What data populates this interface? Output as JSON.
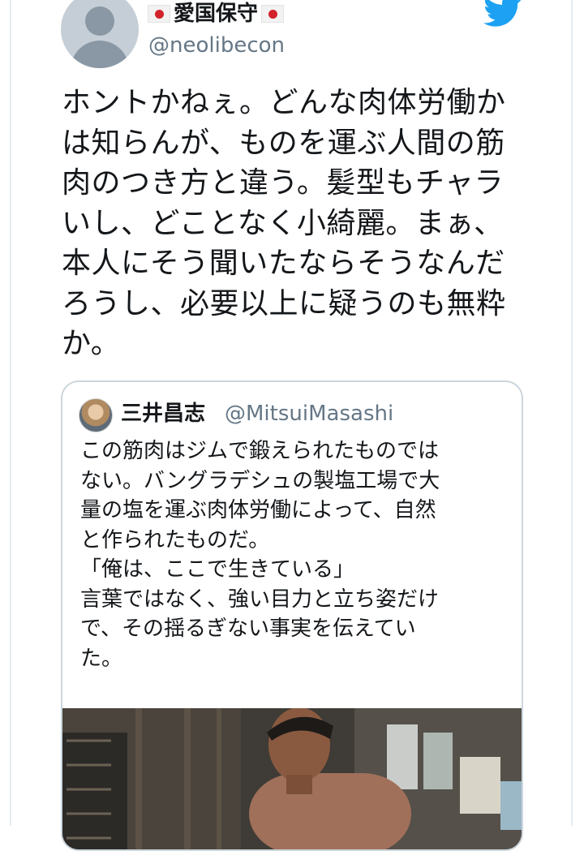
{
  "author": {
    "display_name": "愛国保守",
    "handle": "@neolibecon",
    "avatar_icon": "default-profile-icon",
    "flag_icon": "japan-flag-icon"
  },
  "brand": {
    "icon": "twitter-bird-icon",
    "color": "#1da1f2"
  },
  "tweet": {
    "lines": [
      "ホントかねぇ。どんな肉体労働か",
      "は知らんが、ものを運ぶ人間の筋",
      "肉のつき方と違う。髪型もチャラ",
      "いし、どことなく小綺麗。まぁ、",
      "本人にそう聞いたならそうなんだ",
      "ろうし、必要以上に疑うのも無粋",
      "か。"
    ]
  },
  "quoted_tweet": {
    "display_name": "三井昌志",
    "handle": "@MitsuiMasashi",
    "lines": [
      "この筋肉はジムで鍛えられたものではな",
      "い。バングラデシュの製塩工場で大量の",
      "塩を運ぶ肉体労働によって、自然と作ら",
      "れたものだ。",
      "「俺は、ここで生きている」",
      "言葉ではなく、強い目力と立ち姿だけで、",
      "その揺るぎない事実を伝えていた。"
    ],
    "display_lines": [
      "この筋肉はジムで鍛えられたものでは",
      "ない。バングラデシュの製塩工場で大",
      "量の塩を運ぶ肉体労働によって、自然",
      "と作られたものだ。",
      "「俺は、ここで生きている」",
      "言葉ではなく、強い目力と立ち姿だけ",
      "で、その揺るぎない事実を伝えてい",
      "た。"
    ],
    "photo": "worker-photo"
  }
}
